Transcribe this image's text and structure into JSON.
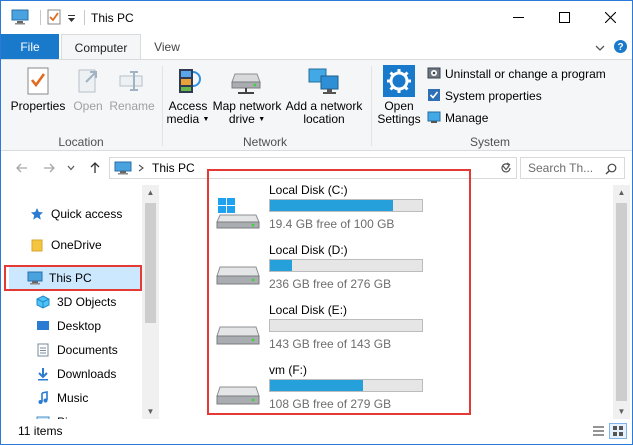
{
  "window": {
    "title": "This PC"
  },
  "ribbon_tabs": {
    "file": "File",
    "computer": "Computer",
    "view": "View"
  },
  "ribbon": {
    "location": {
      "label": "Location",
      "properties": "Properties",
      "open": "Open",
      "rename": "Rename"
    },
    "network": {
      "label": "Network",
      "access_media_1": "Access",
      "access_media_2": "media",
      "map_drive_1": "Map network",
      "map_drive_2": "drive",
      "add_location_1": "Add a network",
      "add_location_2": "location"
    },
    "system": {
      "label": "System",
      "open_settings_1": "Open",
      "open_settings_2": "Settings",
      "uninstall": "Uninstall or change a program",
      "system_properties": "System properties",
      "manage": "Manage"
    }
  },
  "address": {
    "path": "This PC",
    "search_placeholder": "Search Th..."
  },
  "nav": {
    "items": [
      {
        "label": "Quick access",
        "icon": "star-icon"
      },
      {
        "label": "OneDrive",
        "icon": "folder-icon"
      },
      {
        "label": "This PC",
        "icon": "computer-icon"
      },
      {
        "label": "3D Objects",
        "icon": "cube-icon"
      },
      {
        "label": "Desktop",
        "icon": "desktop-icon"
      },
      {
        "label": "Documents",
        "icon": "document-icon"
      },
      {
        "label": "Downloads",
        "icon": "download-icon"
      },
      {
        "label": "Music",
        "icon": "music-icon"
      },
      {
        "label": "Pi",
        "icon": "pictures-icon"
      }
    ]
  },
  "drives": [
    {
      "name": "Local Disk (C:)",
      "free_text": "19.4 GB free of 100 GB",
      "used_fraction": 0.806,
      "icon": "windows-drive-icon"
    },
    {
      "name": "Local Disk (D:)",
      "free_text": "236 GB free of 276 GB",
      "used_fraction": 0.145,
      "icon": "hard-drive-icon"
    },
    {
      "name": "Local Disk (E:)",
      "free_text": "143 GB free of 143 GB",
      "used_fraction": 0.0,
      "icon": "hard-drive-icon"
    },
    {
      "name": "vm (F:)",
      "free_text": "108 GB free of 279 GB",
      "used_fraction": 0.613,
      "icon": "hard-drive-icon"
    }
  ],
  "status": {
    "item_count": "11 items"
  },
  "colors": {
    "accent": "#1979ca",
    "progress": "#26a0da",
    "highlight": "#e53935",
    "selected": "#cce8ff"
  }
}
